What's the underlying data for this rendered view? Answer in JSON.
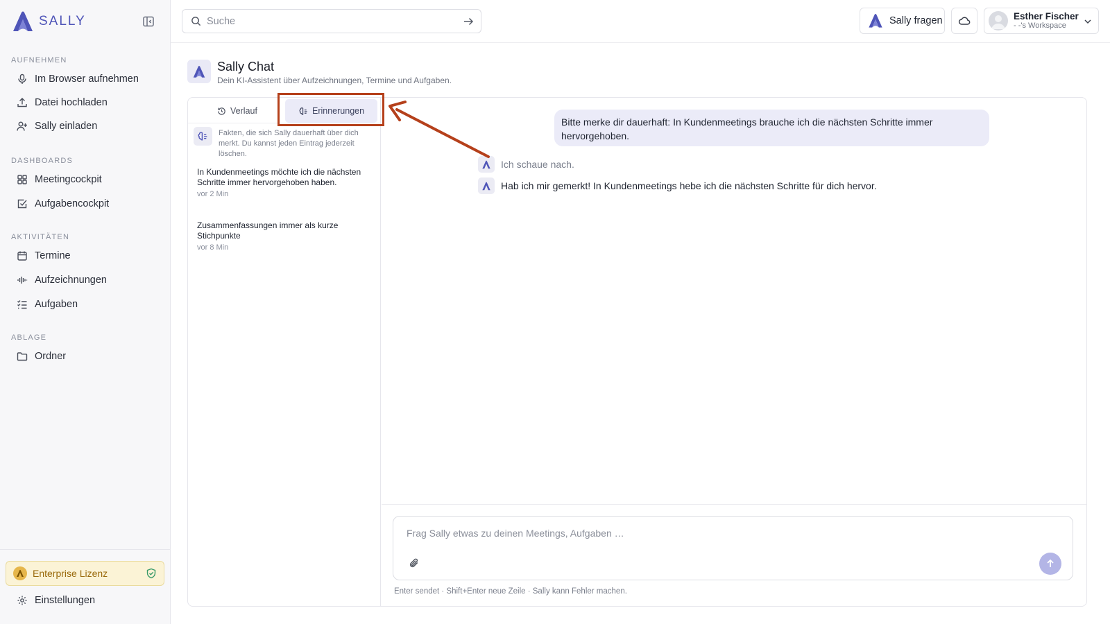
{
  "app": {
    "brand": "SALLY"
  },
  "sidebar": {
    "sections": [
      {
        "label": "AUFNEHMEN",
        "items": [
          {
            "label": "Im Browser aufnehmen",
            "icon": "microphone-icon"
          },
          {
            "label": "Datei hochladen",
            "icon": "upload-icon"
          },
          {
            "label": "Sally einladen",
            "icon": "user-plus-icon"
          }
        ]
      },
      {
        "label": "DASHBOARDS",
        "items": [
          {
            "label": "Meetingcockpit",
            "icon": "grid-icon"
          },
          {
            "label": "Aufgabencockpit",
            "icon": "checkbox-icon"
          }
        ]
      },
      {
        "label": "AKTIVITÄTEN",
        "items": [
          {
            "label": "Termine",
            "icon": "calendar-icon"
          },
          {
            "label": "Aufzeichnungen",
            "icon": "audio-wave-icon"
          },
          {
            "label": "Aufgaben",
            "icon": "checklist-icon"
          }
        ]
      },
      {
        "label": "ABLAGE",
        "items": [
          {
            "label": "Ordner",
            "icon": "folder-icon"
          }
        ]
      }
    ],
    "license": "Enterprise Lizenz",
    "settings": "Einstellungen"
  },
  "topbar": {
    "search_placeholder": "Suche",
    "ask_label": "Sally fragen",
    "user_name": "Esther Fischer",
    "workspace": "- -'s Workspace"
  },
  "chat": {
    "title": "Sally Chat",
    "subtitle": "Dein KI-Assistent über Aufzeichnungen, Termine und Aufgaben.",
    "tabs": {
      "history": "Verlauf",
      "memories": "Erinnerungen"
    },
    "active_tab": "Erinnerungen",
    "memory_info": "Fakten, die sich Sally dauerhaft über dich merkt. Du kannst jeden Eintrag jederzeit löschen.",
    "memories": [
      {
        "text": "In Kundenmeetings möchte ich die nächsten Schritte immer hervorgehoben haben.",
        "age": "vor 2 Min"
      },
      {
        "text": "Zusammenfassungen immer als kurze Stichpunkte",
        "age": "vor 8 Min"
      }
    ],
    "messages": {
      "user": "Bitte merke dir dauerhaft: In Kundenmeetings brauche ich die nächsten Schritte immer hervorgehoben.",
      "bot_status": "Ich schaue nach.",
      "bot_reply": "Hab ich mir gemerkt! In Kundenmeetings hebe ich die nächsten Schritte für dich hervor."
    },
    "composer_placeholder": "Frag Sally etwas zu deinen Meetings, Aufgaben …",
    "composer_hint": "Enter sendet · Shift+Enter neue Zeile · Sally kann Fehler machen."
  },
  "colors": {
    "accent": "#4f55b8",
    "annotation": "#b5401b",
    "license_bg": "#fbf3d6"
  }
}
